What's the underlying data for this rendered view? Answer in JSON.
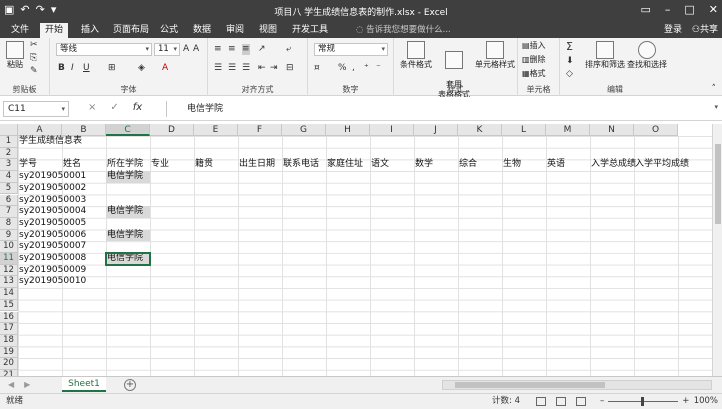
{
  "titlebar": {
    "title": "项目八 学生成绩信息表的制作.xlsx - Excel",
    "save_icon": "save-icon",
    "undo_icon": "undo-icon",
    "redo_icon": "redo-icon"
  },
  "tabs": {
    "items": [
      "文件",
      "开始",
      "插入",
      "页面布局",
      "公式",
      "数据",
      "审阅",
      "视图",
      "开发工具"
    ],
    "active": "开始",
    "search_placeholder": "告诉我您想要做什么...",
    "login": "登录",
    "share": "共享"
  },
  "ribbon": {
    "clipboard": {
      "label": "剪贴板",
      "paste": "粘贴"
    },
    "font": {
      "label": "字体",
      "name": "等线",
      "size": "11",
      "bold": "B",
      "italic": "I",
      "underline": "U"
    },
    "alignment": {
      "label": "对齐方式"
    },
    "number": {
      "label": "数字",
      "format": "常规",
      "percent": "%",
      "comma": ","
    },
    "styles": {
      "label": "样式",
      "conditional": "条件格式",
      "table": "套用\n表格格式",
      "cell": "单元格样式"
    },
    "cells": {
      "label": "单元格",
      "insert": "插入",
      "delete": "删除",
      "format": "格式"
    },
    "editing": {
      "label": "编辑",
      "sort": "排序和筛选",
      "find": "查找和选择",
      "sigma": "Σ"
    }
  },
  "formula_bar": {
    "name_box": "C11",
    "cancel": "×",
    "enter": "✓",
    "fx": "fx",
    "value": "电信学院"
  },
  "grid": {
    "columns": [
      "A",
      "B",
      "C",
      "D",
      "E",
      "F",
      "G",
      "H",
      "I",
      "J",
      "K",
      "L",
      "M",
      "N",
      "O"
    ],
    "rows": [
      "1",
      "2",
      "3",
      "4",
      "5",
      "6",
      "7",
      "8",
      "9",
      "10",
      "11",
      "12",
      "13",
      "14",
      "15",
      "16",
      "17",
      "18",
      "19",
      "20",
      "21"
    ],
    "selected_col": "C",
    "selected_row": "11",
    "cells": {
      "A1": "学生成绩信息表",
      "A3": "学号",
      "B3": "姓名",
      "C3": "所在学院",
      "D3": "专业",
      "E3": "籍贯",
      "F3": "出生日期",
      "G3": "联系电话",
      "H3": "家庭住址",
      "I3": "语文",
      "J3": "数学",
      "K3": "综合",
      "L3": "生物",
      "M3": "英语",
      "N3": "入学总成绩",
      "O3": "入学平均成绩",
      "A4": "sy2019050001",
      "C4": "电信学院",
      "A5": "sy2019050002",
      "A6": "sy2019050003",
      "A7": "sy2019050004",
      "C7": "电信学院",
      "A8": "sy2019050005",
      "A9": "sy2019050006",
      "C9": "电信学院",
      "A10": "sy2019050007",
      "A11": "sy2019050008",
      "C11": "电信学院",
      "A12": "sy2019050009",
      "A13": "sy2019050010"
    }
  },
  "sheets": {
    "tabs": [
      "Sheet1"
    ],
    "active": "Sheet1",
    "add": "+"
  },
  "status": {
    "ready": "就绪",
    "count": "计数: 4",
    "zoom": "100%"
  }
}
